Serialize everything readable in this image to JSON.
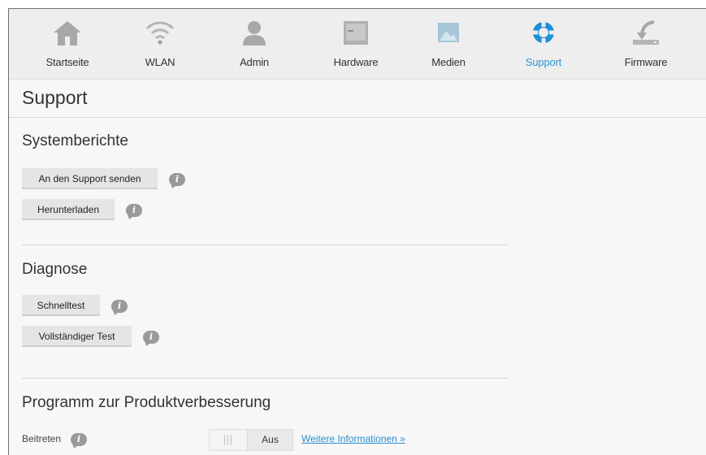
{
  "nav": {
    "items": [
      {
        "label": "Startseite",
        "icon": "home-icon"
      },
      {
        "label": "WLAN",
        "icon": "wifi-icon"
      },
      {
        "label": "Admin",
        "icon": "admin-user-icon"
      },
      {
        "label": "Hardware",
        "icon": "hardware-icon"
      },
      {
        "label": "Medien",
        "icon": "media-image-icon"
      },
      {
        "label": "Support",
        "icon": "support-lifebuoy-icon",
        "active": true
      },
      {
        "label": "Firmware",
        "icon": "firmware-download-icon"
      }
    ]
  },
  "page": {
    "title": "Support"
  },
  "systemberichte": {
    "title": "Systemberichte",
    "send_label": "An den Support senden",
    "download_label": "Herunterladen"
  },
  "diagnose": {
    "title": "Diagnose",
    "quick_label": "Schnelltest",
    "full_label": "Vollständiger Test"
  },
  "program": {
    "title": "Programm zur Produktverbesserung",
    "join_label": "Beitreten",
    "toggle_state": "Aus",
    "more_info": "Weitere Informationen »"
  },
  "info_glyph": "i",
  "colors": {
    "accent": "#2a98d9",
    "nav_background": "#eeeeee",
    "page_background": "#f7f7f7",
    "button": "#e5e5e5",
    "info_badge": "#9a9a9a",
    "link": "#2a8ed4"
  }
}
